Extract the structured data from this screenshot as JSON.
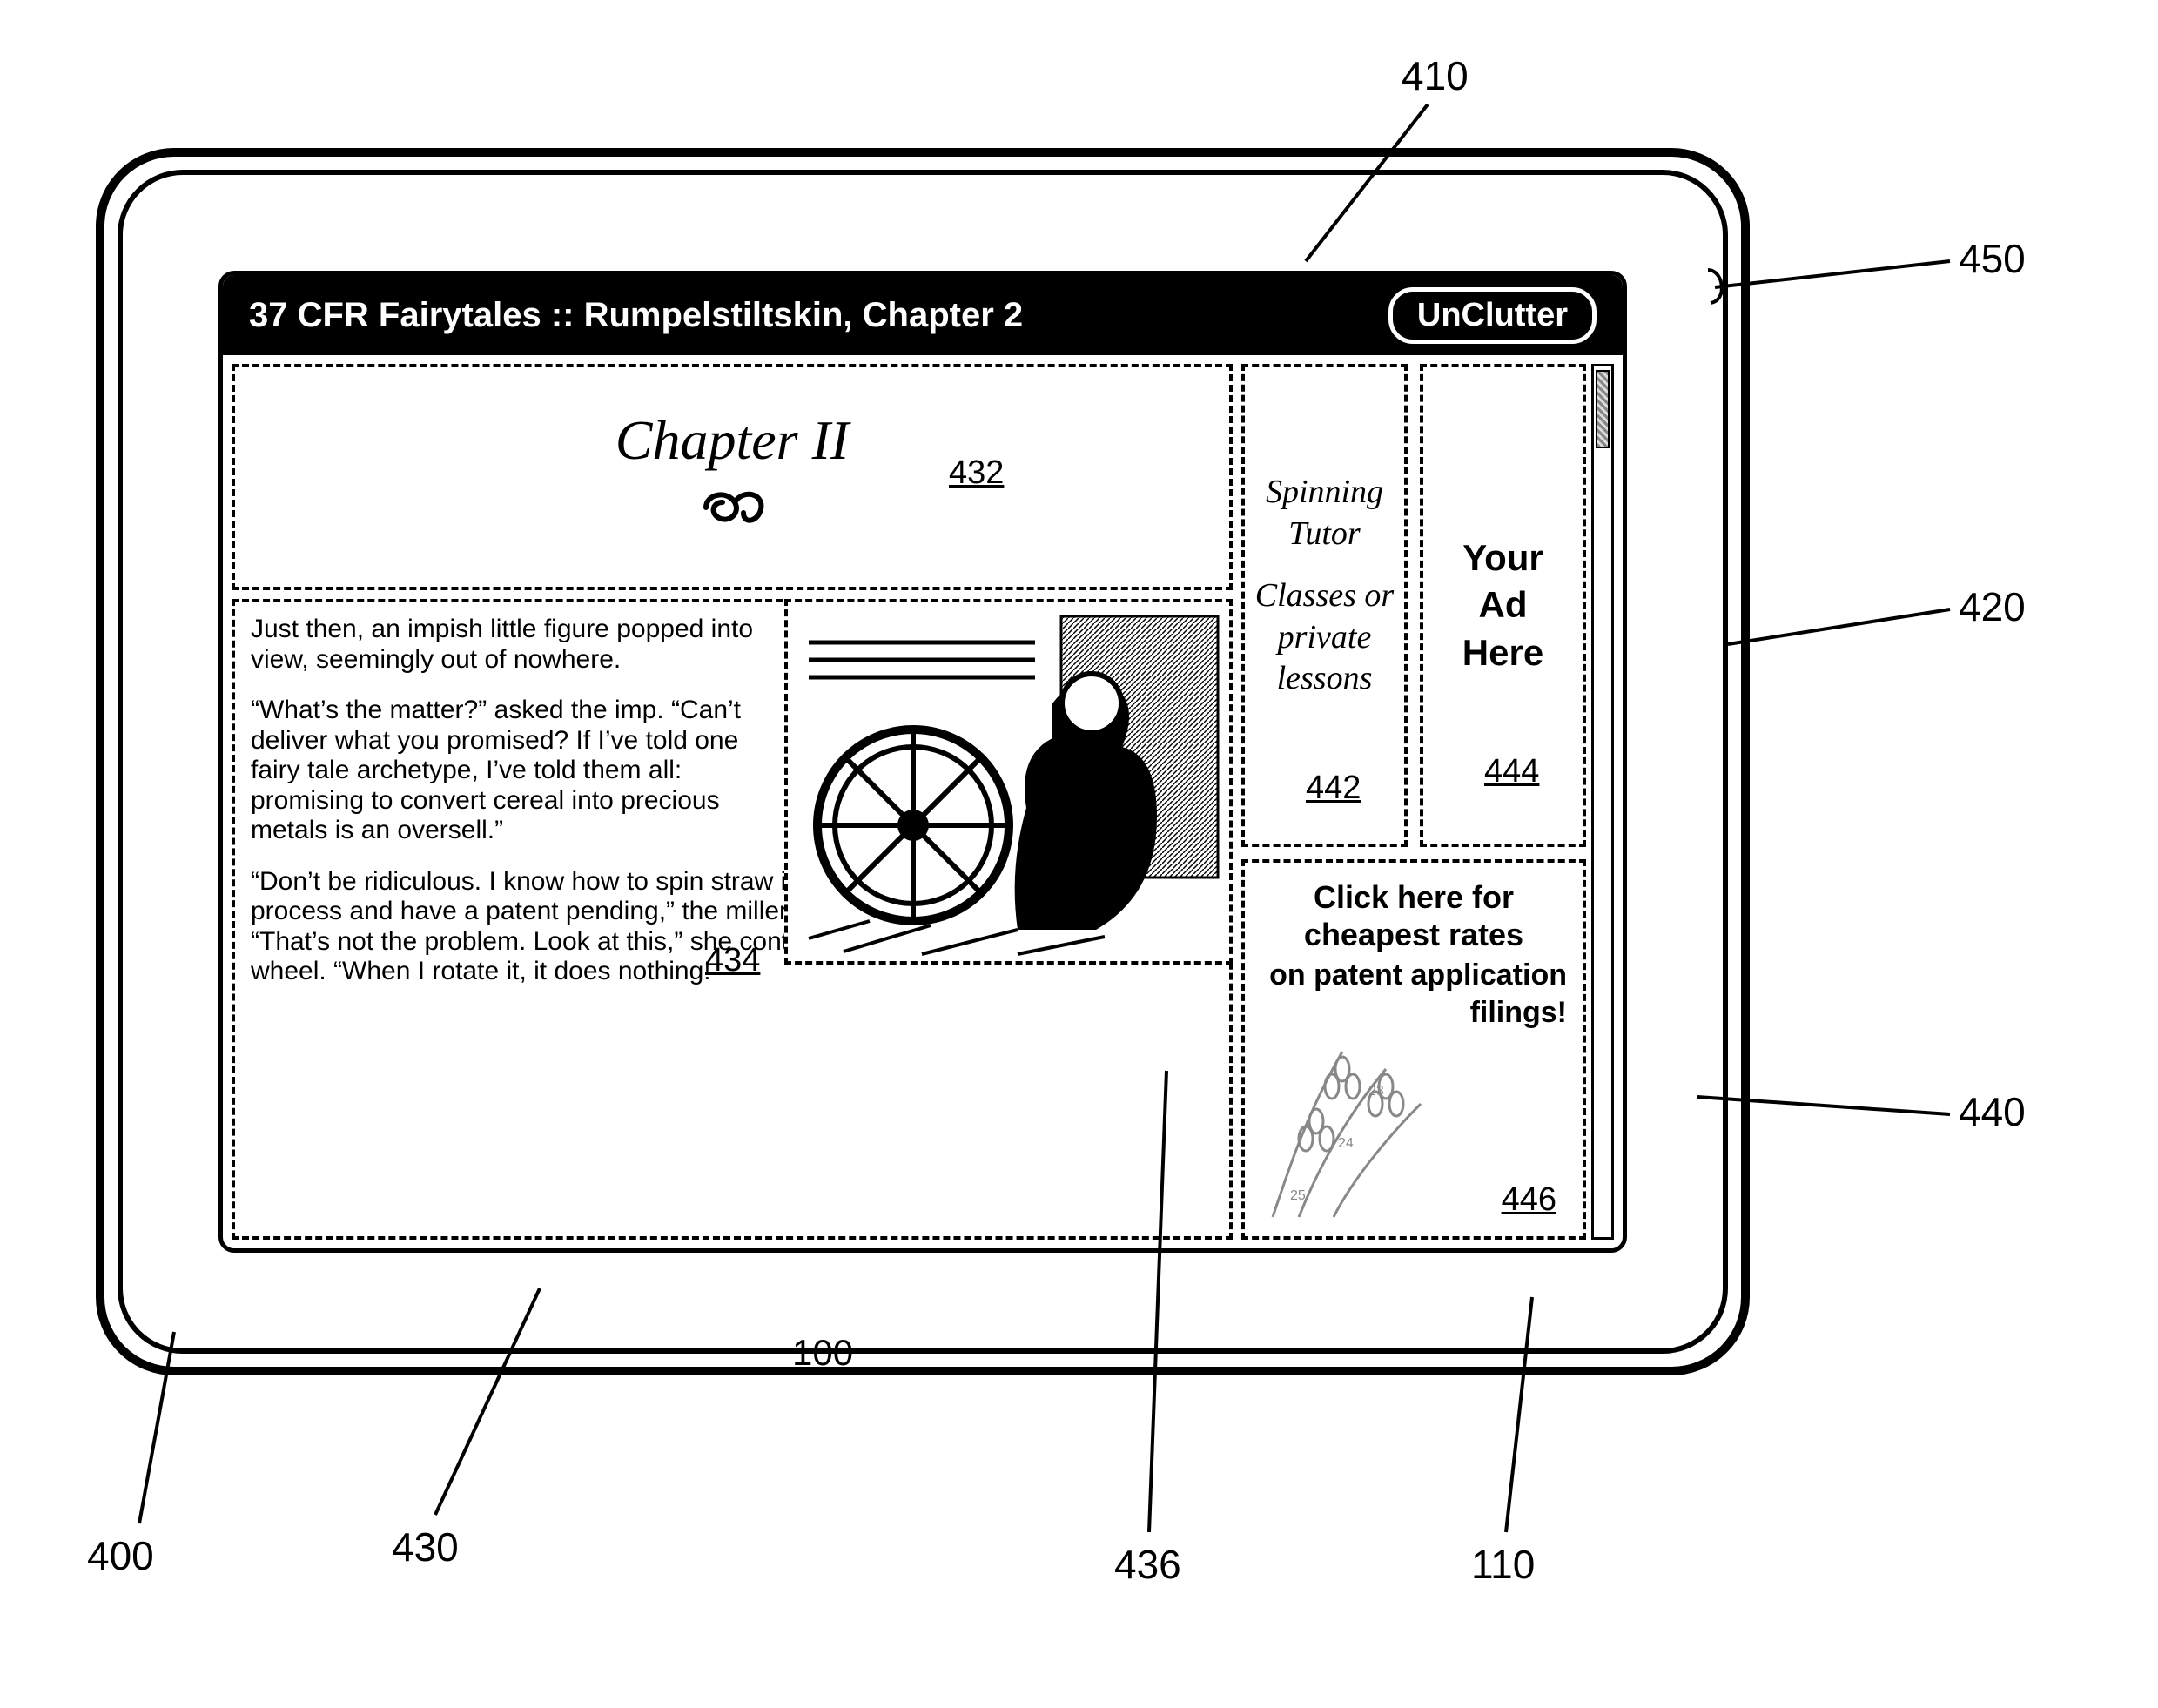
{
  "refs": {
    "r400": "400",
    "r410": "410",
    "r420": "420",
    "r430": "430",
    "r432": "432",
    "r434": "434",
    "r436": "436",
    "r440": "440",
    "r442": "442",
    "r444": "444",
    "r446": "446",
    "r450": "450",
    "r100": "100",
    "r110": "110"
  },
  "titlebar": {
    "title": "37 CFR Fairytales :: Rumpelstiltskin, Chapter 2",
    "button": "UnClutter"
  },
  "chapter": {
    "title": "Chapter II",
    "flourish": "œ"
  },
  "story": {
    "p1": "Just then, an impish little figure popped into view, seemingly out of nowhere.",
    "p2": "“What’s the matter?” asked the imp. “Can’t deliver what you promised? If I’ve told one fairy tale archetype, I’ve told them all: promising to convert cereal into precious metals is an oversell.”",
    "p3": "“Don’t be ridiculous. I know how to spin straw into gold—in fact, I developed the process and have a patent pending,” the miller’s daughter indignantly replied. “That’s not the problem. Look at this,” she continued, pointing to the inanimate wheel. “When I rotate it, it does nothing!"
  },
  "ads": {
    "a442": {
      "line1": "Spinning Tutor",
      "line2": "Classes or private lessons"
    },
    "a444": {
      "line1": "Your",
      "line2": "Ad",
      "line3": "Here"
    },
    "a446": {
      "headline": "Click here for cheapest rates",
      "sub": "on patent application filings!"
    }
  }
}
